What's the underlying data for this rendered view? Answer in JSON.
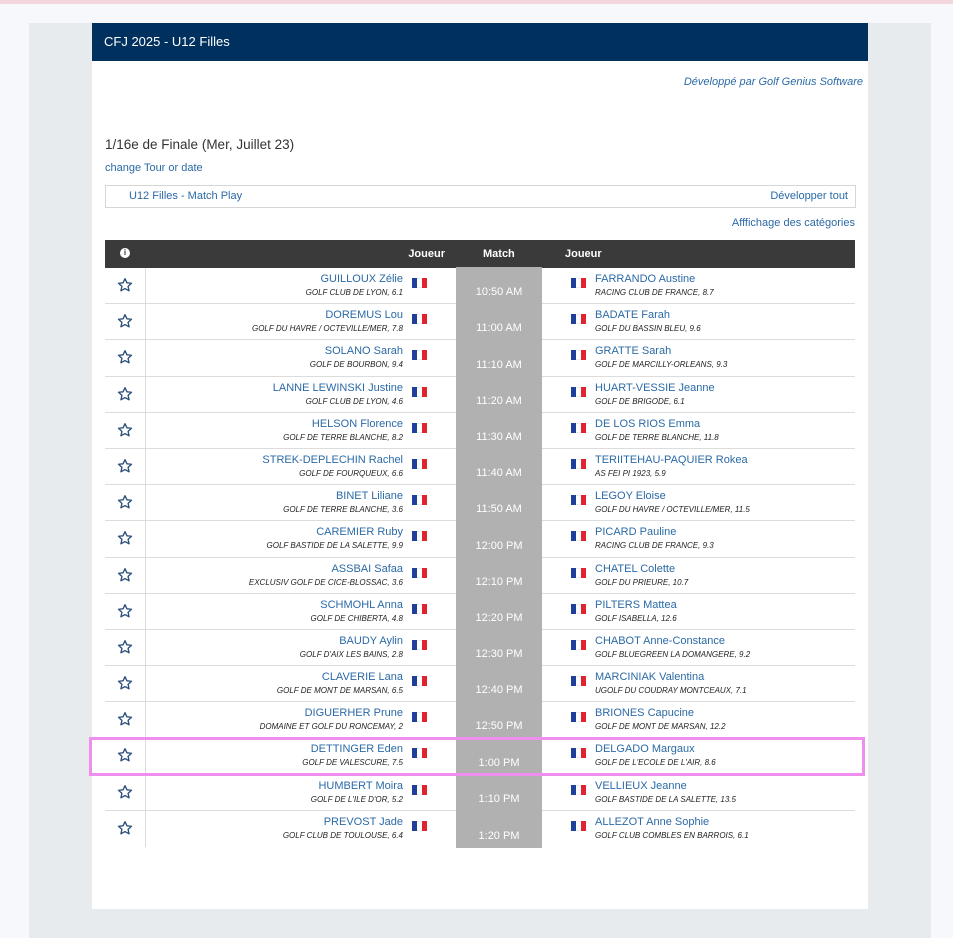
{
  "header": {
    "title": "CFJ 2025 - U12 Filles"
  },
  "developer_link": "Développé par Golf Genius Software",
  "round_title": "1/16e de Finale (Mer, Juillet 23)",
  "change_link": "change Tour or date",
  "filter": {
    "label": "U12 Filles - Match Play",
    "expand": "Développer tout"
  },
  "categories_link": "Afffichage des catégories",
  "table": {
    "info_icon": "info-icon",
    "headers": {
      "player1": "Joueur",
      "match": "Match",
      "player2": "Joueur"
    },
    "rows": [
      {
        "p1": "GUILLOUX Zélie",
        "c1": "GOLF CLUB DE LYON, 6.1",
        "time": "10:50 AM",
        "p2": "FARRANDO Austine",
        "c2": "RACING CLUB DE FRANCE, 8.7"
      },
      {
        "p1": "DOREMUS Lou",
        "c1": "GOLF DU HAVRE / OCTEVILLE/MER, 7.8",
        "time": "11:00 AM",
        "p2": "BADATE Farah",
        "c2": "GOLF DU BASSIN BLEU, 9.6"
      },
      {
        "p1": "SOLANO Sarah",
        "c1": "GOLF DE BOURBON, 9.4",
        "time": "11:10 AM",
        "p2": "GRATTE Sarah",
        "c2": "GOLF DE MARCILLY-ORLEANS, 9.3"
      },
      {
        "p1": "LANNE LEWINSKI Justine",
        "c1": "GOLF CLUB DE LYON, 4.6",
        "time": "11:20 AM",
        "p2": "HUART-VESSIE Jeanne",
        "c2": "GOLF DE BRIGODE, 6.1"
      },
      {
        "p1": "HELSON Florence",
        "c1": "GOLF DE TERRE BLANCHE, 8.2",
        "time": "11:30 AM",
        "p2": "DE LOS RIOS Emma",
        "c2": "GOLF DE TERRE BLANCHE, 11.8"
      },
      {
        "p1": "STREK-DEPLECHIN Rachel",
        "c1": "GOLF DE FOURQUEUX, 6.6",
        "time": "11:40 AM",
        "p2": "TERIITEHAU-PAQUIER Rokea",
        "c2": "AS FEI PI 1923, 5.9"
      },
      {
        "p1": "BINET Liliane",
        "c1": "GOLF DE TERRE BLANCHE, 3.6",
        "time": "11:50 AM",
        "p2": "LEGOY Eloise",
        "c2": "GOLF DU HAVRE / OCTEVILLE/MER, 11.5"
      },
      {
        "p1": "CAREMIER Ruby",
        "c1": "GOLF BASTIDE DE LA SALETTE, 9.9",
        "time": "12:00 PM",
        "p2": "PICARD Pauline",
        "c2": "RACING CLUB DE FRANCE, 9.3"
      },
      {
        "p1": "ASSBAI Safaa",
        "c1": "EXCLUSIV GOLF DE CICE-BLOSSAC, 3.6",
        "time": "12:10 PM",
        "p2": "CHATEL Colette",
        "c2": "GOLF DU PRIEURE, 10.7"
      },
      {
        "p1": "SCHMOHL Anna",
        "c1": "GOLF DE CHIBERTA, 4.8",
        "time": "12:20 PM",
        "p2": "PILTERS Mattea",
        "c2": "GOLF ISABELLA, 12.6"
      },
      {
        "p1": "BAUDY Aylin",
        "c1": "GOLF D'AIX LES BAINS, 2.8",
        "time": "12:30 PM",
        "p2": "CHABOT Anne-Constance",
        "c2": "GOLF BLUEGREEN LA DOMANGERE, 9.2"
      },
      {
        "p1": "CLAVERIE Lana",
        "c1": "GOLF DE MONT DE MARSAN, 6.5",
        "time": "12:40 PM",
        "p2": "MARCINIAK Valentina",
        "c2": "UGOLF DU COUDRAY MONTCEAUX, 7.1"
      },
      {
        "p1": "DIGUERHER Prune",
        "c1": "DOMAINE ET GOLF DU RONCEMAY, 2",
        "time": "12:50 PM",
        "p2": "BRIONES Capucine",
        "c2": "GOLF DE MONT DE MARSAN, 12.2"
      },
      {
        "p1": "DETTINGER Eden",
        "c1": "GOLF DE VALESCURE, 7.5",
        "time": "1:00 PM",
        "p2": "DELGADO Margaux",
        "c2": "GOLF DE L'ECOLE DE L'AIR, 8.6"
      },
      {
        "p1": "HUMBERT Moira",
        "c1": "GOLF DE L'ILE D'OR, 5.2",
        "time": "1:10 PM",
        "p2": "VELLIEUX Jeanne",
        "c2": "GOLF BASTIDE DE LA SALETTE, 13.5"
      },
      {
        "p1": "PREVOST Jade",
        "c1": "GOLF CLUB DE TOULOUSE, 6.4",
        "time": "1:20 PM",
        "p2": "ALLEZOT Anne Sophie",
        "c2": "GOLF CLUB COMBLES EN BARROIS, 6.1"
      }
    ]
  },
  "colors": {
    "header_bg": "#00305d",
    "link": "#2b6aa6",
    "match_bg": "#b1b1b1",
    "highlight": "#f08ef0"
  }
}
